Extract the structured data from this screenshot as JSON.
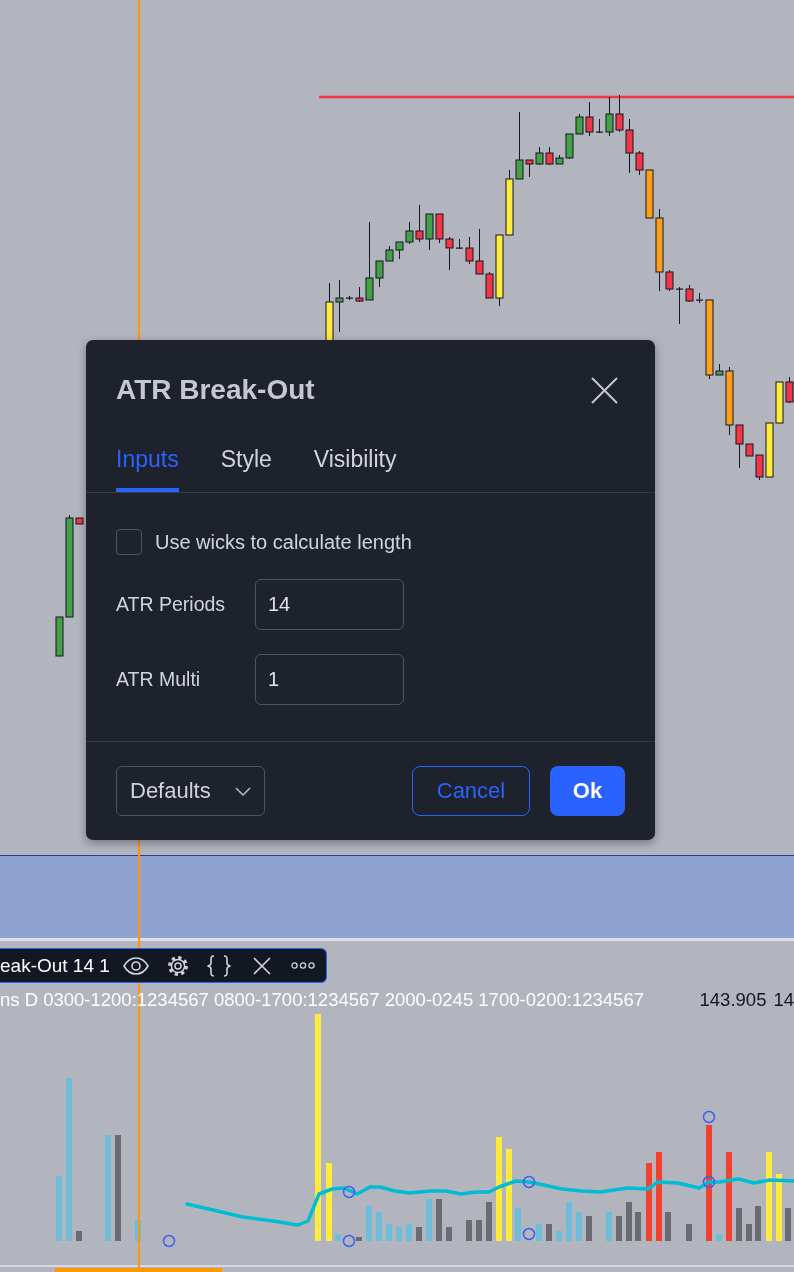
{
  "dialog": {
    "title": "ATR Break-Out",
    "tabs": [
      {
        "label": "Inputs",
        "selected": true
      },
      {
        "label": "Style",
        "selected": false
      },
      {
        "label": "Visibility",
        "selected": false
      }
    ],
    "inputs": [
      {
        "kind": "checkbox",
        "label": "Use wicks to calculate length",
        "checked": false
      },
      {
        "kind": "number",
        "label": "ATR Periods",
        "value": "14"
      },
      {
        "kind": "number",
        "label": "ATR Multi",
        "value": "1"
      }
    ],
    "defaults_menu": {
      "label": "Defaults"
    },
    "buttons": [
      {
        "kind": "secondary",
        "label": "Cancel"
      },
      {
        "kind": "primary",
        "label": "Ok"
      }
    ]
  },
  "indicator_legend": {
    "title": "eak-Out 14 1",
    "inputs_text": "ns D 0300-1200:1234567 0800-1700:1234567 2000-0245 1700-0200:1234567",
    "values": [
      "143.905",
      "14"
    ]
  }
}
